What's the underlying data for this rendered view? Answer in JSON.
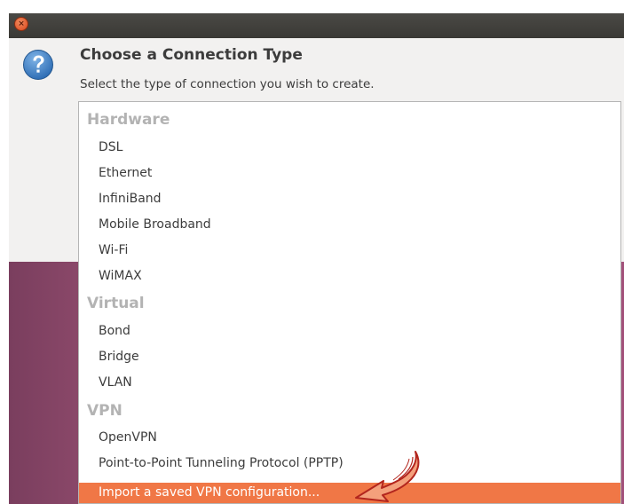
{
  "window": {
    "close_glyph": "×"
  },
  "dialog": {
    "title": "Choose a Connection Type",
    "subtitle": "Select the type of connection you wish to create.",
    "icon": "question-icon"
  },
  "menu": {
    "hardware_header": "Hardware",
    "hardware_items": [
      "DSL",
      "Ethernet",
      "InfiniBand",
      "Mobile Broadband",
      "Wi-Fi",
      "WiMAX"
    ],
    "virtual_header": "Virtual",
    "virtual_items": [
      "Bond",
      "Bridge",
      "VLAN"
    ],
    "vpn_header": "VPN",
    "vpn_items": [
      "OpenVPN",
      "Point-to-Point Tunneling Protocol (PPTP)"
    ],
    "selected_item": "Import a saved VPN configuration..."
  },
  "colors": {
    "highlight": "#f07746",
    "group_header": "#b3b3b3",
    "titlebar": "#3e3d39",
    "desktop": "#a4577a",
    "annotation_arrow": "#c0392b"
  }
}
